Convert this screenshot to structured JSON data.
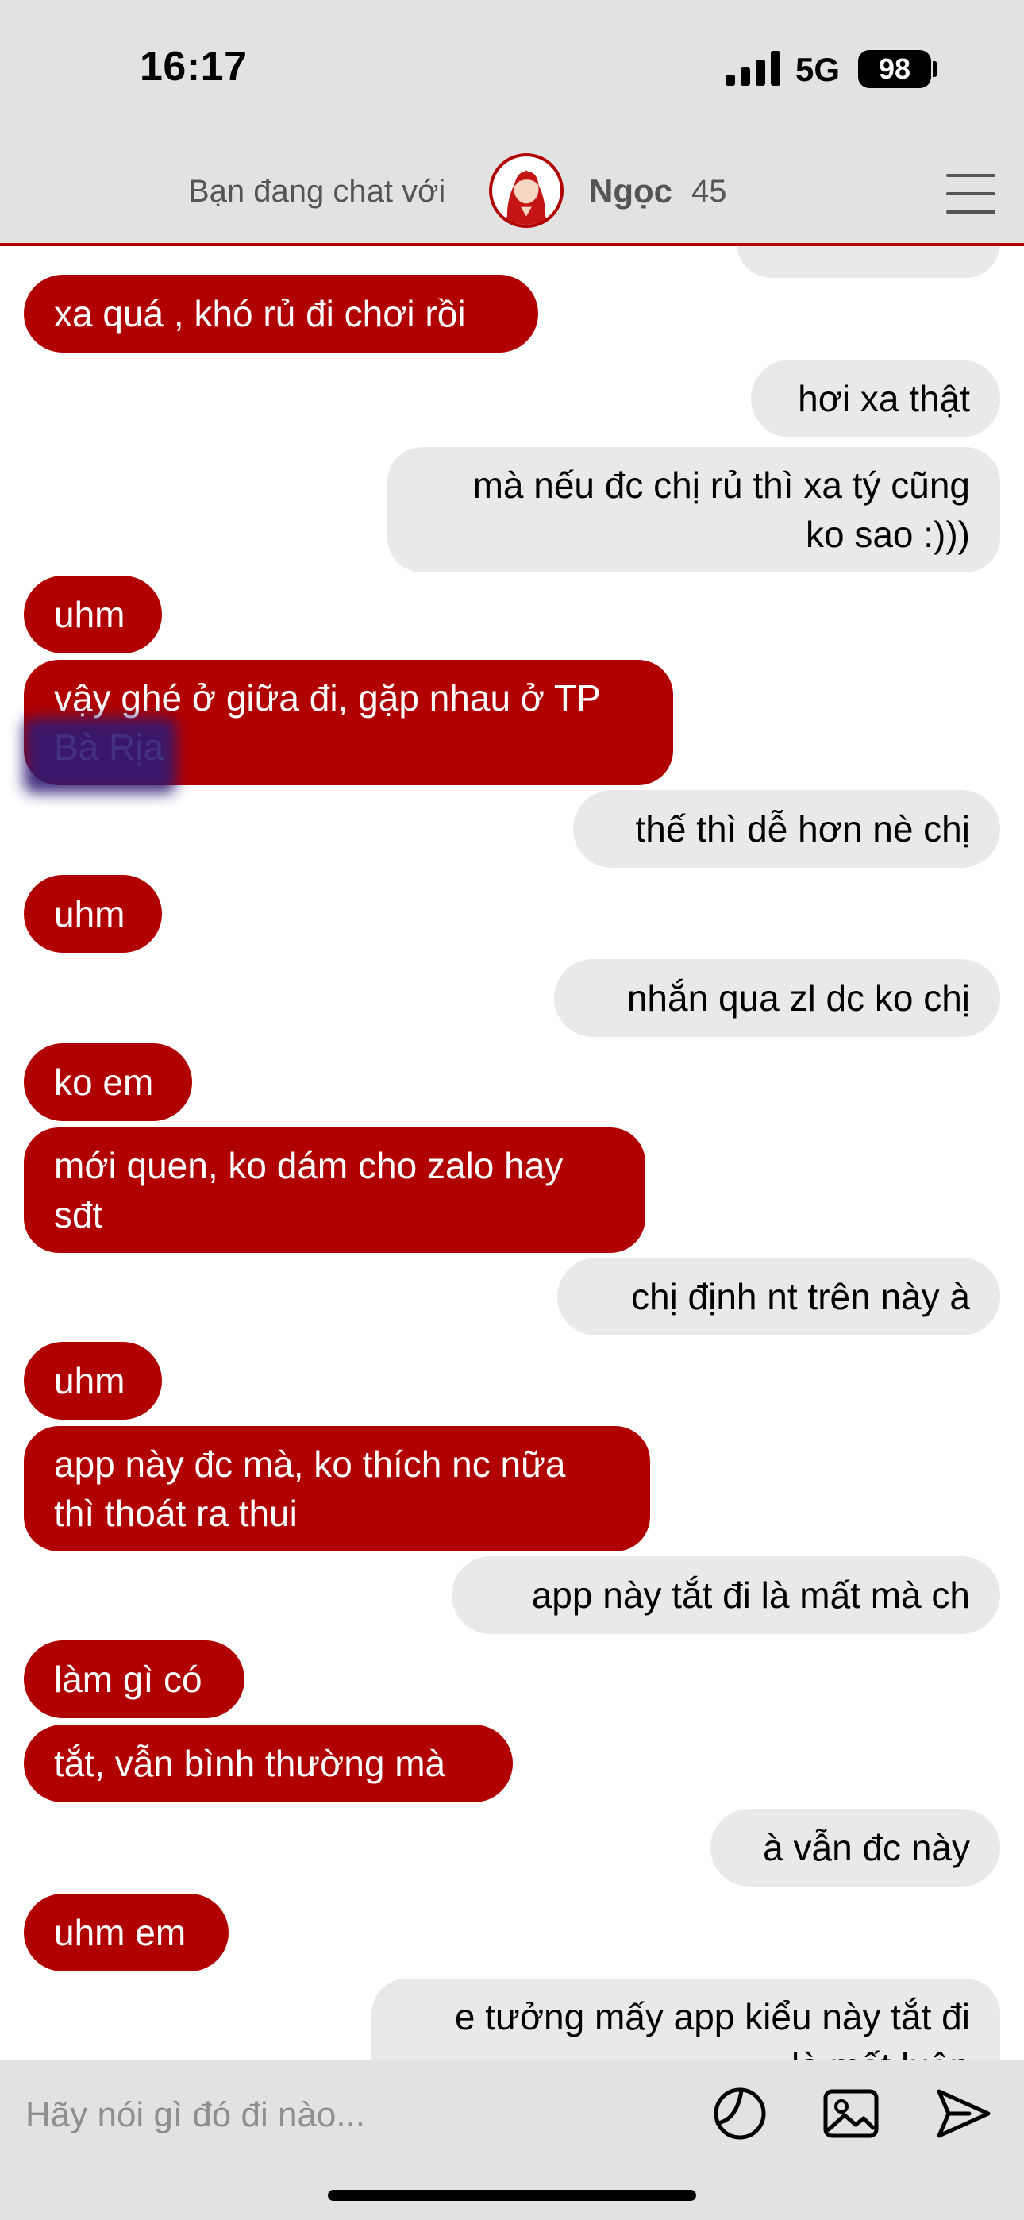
{
  "status_bar": {
    "time": "16:17",
    "network": "5G",
    "battery": "98",
    "icons": [
      "signal-bars-icon",
      "battery-icon"
    ]
  },
  "header": {
    "prefix": "Bạn đang chat với",
    "name": "Ngọc",
    "age": "45",
    "avatar_icon": "avatar-woman-icon",
    "menu_icon": "hamburger-menu-icon"
  },
  "colors": {
    "accent": "#b10000",
    "incoming_bubble": "#b10000",
    "outgoing_bubble": "#e9e9e9",
    "bar_background": "#e2e2e2"
  },
  "messages": [
    {
      "from": "them",
      "lines": [
        "xa quá , khó rủ đi chơi rồi"
      ]
    },
    {
      "from": "me",
      "lines": [
        "hơi xa thật"
      ]
    },
    {
      "from": "me",
      "lines": [
        "mà nếu đc chị rủ thì xa tý cũng",
        "ko sao :)))"
      ]
    },
    {
      "from": "them",
      "lines": [
        "uhm"
      ]
    },
    {
      "from": "them",
      "lines": [
        "vậy ghé ở giữa đi, gặp nhau ở TP",
        "Bà Rịa"
      ]
    },
    {
      "from": "me",
      "lines": [
        "thế thì dễ hơn nè chị"
      ]
    },
    {
      "from": "them",
      "lines": [
        "uhm"
      ]
    },
    {
      "from": "me",
      "lines": [
        "nhắn qua zl dc ko chị"
      ]
    },
    {
      "from": "them",
      "lines": [
        "ko em"
      ]
    },
    {
      "from": "them",
      "lines": [
        "mới quen, ko dám cho zalo hay",
        "sđt"
      ]
    },
    {
      "from": "me",
      "lines": [
        "chị định nt trên này à"
      ]
    },
    {
      "from": "them",
      "lines": [
        "uhm"
      ]
    },
    {
      "from": "them",
      "lines": [
        "app này đc mà, ko thích nc nữa",
        "thì thoát ra thui"
      ]
    },
    {
      "from": "me",
      "lines": [
        "app này tắt đi là mất mà ch"
      ]
    },
    {
      "from": "them",
      "lines": [
        "làm gì có"
      ]
    },
    {
      "from": "them",
      "lines": [
        "tắt, vẫn bình thường mà"
      ]
    },
    {
      "from": "me",
      "lines": [
        "à vẫn đc này"
      ]
    },
    {
      "from": "them",
      "lines": [
        "uhm em"
      ]
    },
    {
      "from": "me",
      "lines": [
        "e tưởng mấy app kiểu này tắt đi",
        "là mất luôn"
      ]
    }
  ],
  "input": {
    "placeholder": "Hãy nói gì đó đi nào...",
    "value": "",
    "icons": [
      "sticker-icon",
      "image-icon",
      "send-icon"
    ]
  }
}
